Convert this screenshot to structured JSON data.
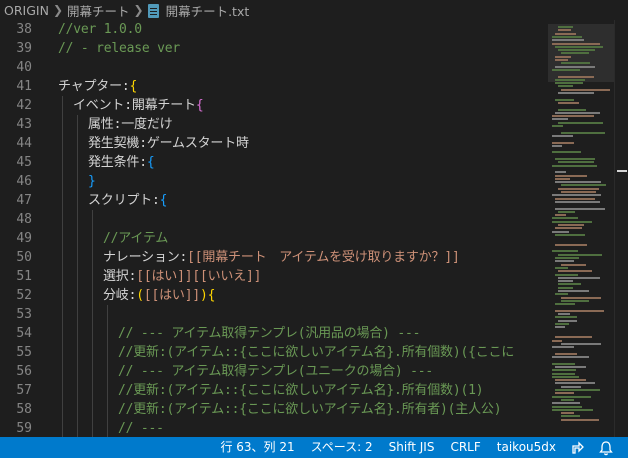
{
  "breadcrumb": {
    "root": "ORIGIN",
    "folder": "開幕チート",
    "file": "開幕チート.txt"
  },
  "editor": {
    "lines": [
      {
        "n": "38",
        "indent": 0,
        "tokens": [
          {
            "t": "//ver 1.0.0",
            "c": "comment"
          }
        ]
      },
      {
        "n": "39",
        "indent": 0,
        "tokens": [
          {
            "t": "// - release ver",
            "c": "comment"
          }
        ]
      },
      {
        "n": "40",
        "indent": 0,
        "tokens": []
      },
      {
        "n": "41",
        "indent": 0,
        "tokens": [
          {
            "t": "チャプター:",
            "c": "teal"
          },
          {
            "t": "{",
            "c": "gold"
          }
        ]
      },
      {
        "n": "42",
        "indent": 1,
        "tokens": [
          {
            "t": "イベント:",
            "c": "teal"
          },
          {
            "t": "開幕チート",
            "c": "white"
          },
          {
            "t": "{",
            "c": "pink"
          }
        ]
      },
      {
        "n": "43",
        "indent": 2,
        "tokens": [
          {
            "t": "属性:一度だけ",
            "c": "white"
          }
        ]
      },
      {
        "n": "44",
        "indent": 2,
        "tokens": [
          {
            "t": "発生契機:ゲームスタート時",
            "c": "white"
          }
        ]
      },
      {
        "n": "45",
        "indent": 2,
        "tokens": [
          {
            "t": "発生条件:",
            "c": "white"
          },
          {
            "t": "{",
            "c": "blue"
          }
        ]
      },
      {
        "n": "46",
        "indent": 2,
        "tokens": [
          {
            "t": "}",
            "c": "blue"
          }
        ]
      },
      {
        "n": "47",
        "indent": 2,
        "tokens": [
          {
            "t": "スクリプト:",
            "c": "white"
          },
          {
            "t": "{",
            "c": "blue"
          }
        ]
      },
      {
        "n": "48",
        "indent": 3,
        "tokens": []
      },
      {
        "n": "49",
        "indent": 3,
        "tokens": [
          {
            "t": "//アイテム",
            "c": "comment"
          }
        ]
      },
      {
        "n": "50",
        "indent": 3,
        "tokens": [
          {
            "t": "ナレーション:",
            "c": "white"
          },
          {
            "t": "[[開幕チート　アイテムを受け取りますか？]]",
            "c": "orange"
          }
        ]
      },
      {
        "n": "51",
        "indent": 3,
        "tokens": [
          {
            "t": "選択:",
            "c": "white"
          },
          {
            "t": "[[はい]][[いいえ]]",
            "c": "orange"
          }
        ]
      },
      {
        "n": "52",
        "indent": 3,
        "tokens": [
          {
            "t": "分岐:",
            "c": "white"
          },
          {
            "t": "(",
            "c": "gold"
          },
          {
            "t": "[[はい]]",
            "c": "orange"
          },
          {
            "t": ")",
            "c": "gold"
          },
          {
            "t": "{",
            "c": "gold"
          }
        ]
      },
      {
        "n": "53",
        "indent": 4,
        "tokens": []
      },
      {
        "n": "54",
        "indent": 4,
        "tokens": [
          {
            "t": "// --- アイテム取得テンプレ(汎用品の場合) ---",
            "c": "comment"
          }
        ]
      },
      {
        "n": "55",
        "indent": 4,
        "tokens": [
          {
            "t": "//更新:(アイテム::{ここに欲しいアイテム名}.所有個数)({ここに",
            "c": "comment"
          }
        ]
      },
      {
        "n": "56",
        "indent": 4,
        "tokens": [
          {
            "t": "// --- アイテム取得テンプレ(ユニークの場合) ---",
            "c": "comment"
          }
        ]
      },
      {
        "n": "57",
        "indent": 4,
        "tokens": [
          {
            "t": "//更新:(アイテム::{ここに欲しいアイテム名}.所有個数)(1)",
            "c": "comment"
          }
        ]
      },
      {
        "n": "58",
        "indent": 4,
        "tokens": [
          {
            "t": "//更新:(アイテム::{ここに欲しいアイテム名}.所有者)(主人公)",
            "c": "comment"
          }
        ]
      },
      {
        "n": "59",
        "indent": 4,
        "tokens": [
          {
            "t": "// ---",
            "c": "comment"
          }
        ]
      }
    ]
  },
  "status_bar": {
    "cursor": "行 63、列 21",
    "indent": "スペース: 2",
    "encoding": "Shift JIS",
    "eol": "CRLF",
    "user": "taikou5dx",
    "icons": [
      "live-share-icon",
      "bell-icon"
    ]
  },
  "colors": {
    "editor_bg": "#1e1e1e",
    "status_bg": "#007acc",
    "comment": "#6a9955",
    "string": "#ce9178",
    "bracket_gold": "#ffd700",
    "bracket_pink": "#da70d6",
    "bracket_blue": "#179fff"
  }
}
